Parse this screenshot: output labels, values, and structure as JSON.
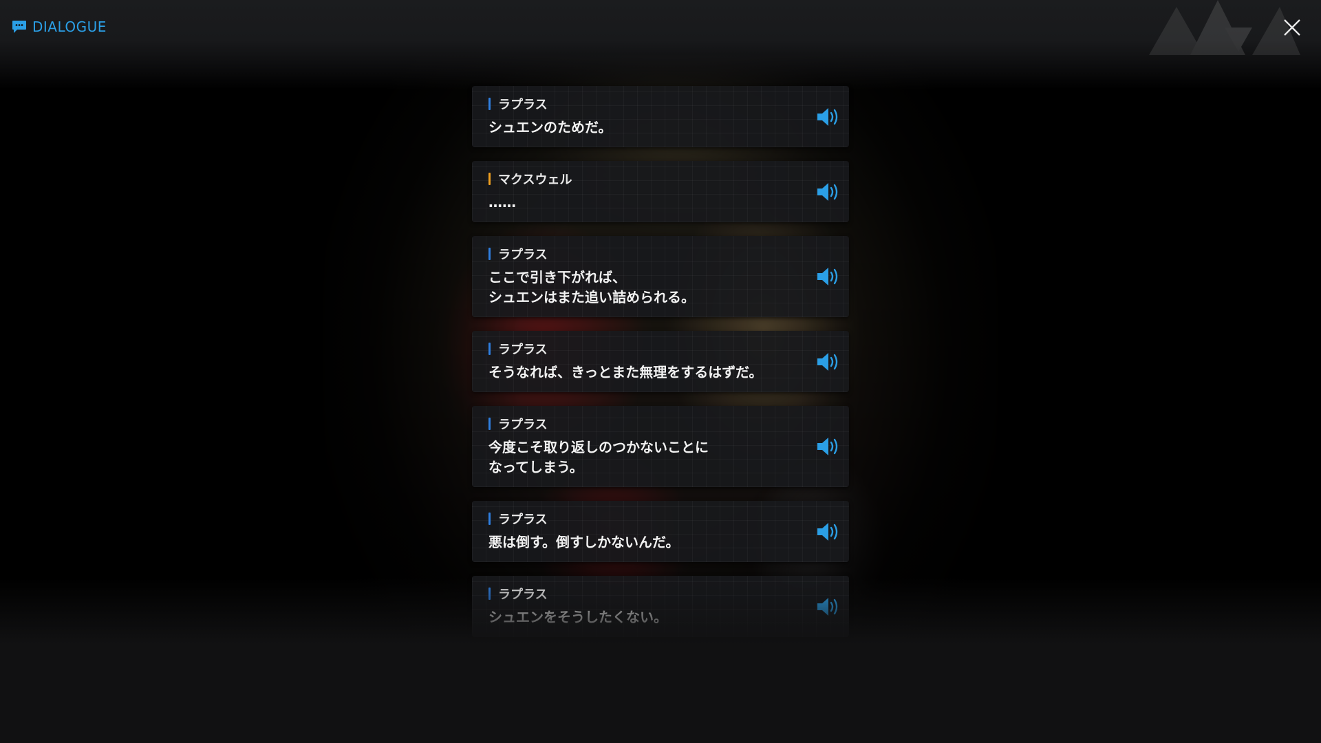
{
  "header": {
    "title": "DIALOGUE",
    "title_icon": "chat-bubble-icon",
    "close_icon": "close-icon"
  },
  "colors": {
    "accent": "#2b9fe6",
    "speaker_blue": "#2f7fe0",
    "speaker_orange": "#f0a020",
    "voice_icon": "#2b9fe6"
  },
  "dialogue": [
    {
      "speaker": "ラプラス",
      "speaker_color": "#2f7fe0",
      "text": "シュエンのためだ。",
      "voice_icon": "speaker-icon"
    },
    {
      "speaker": "マクスウェル",
      "speaker_color": "#f0a020",
      "text": "……",
      "voice_icon": "speaker-icon"
    },
    {
      "speaker": "ラプラス",
      "speaker_color": "#2f7fe0",
      "text": "ここで引き下がれば、\nシュエンはまた追い詰められる。",
      "voice_icon": "speaker-icon"
    },
    {
      "speaker": "ラプラス",
      "speaker_color": "#2f7fe0",
      "text": "そうなれば、きっとまた無理をするはずだ。",
      "voice_icon": "speaker-icon"
    },
    {
      "speaker": "ラプラス",
      "speaker_color": "#2f7fe0",
      "text": "今度こそ取り返しのつかないことに\nなってしまう。",
      "voice_icon": "speaker-icon"
    },
    {
      "speaker": "ラプラス",
      "speaker_color": "#2f7fe0",
      "text": "悪は倒す。倒すしかないんだ。",
      "voice_icon": "speaker-icon"
    },
    {
      "speaker": "ラプラス",
      "speaker_color": "#2f7fe0",
      "text": "シュエンをそうしたくない。",
      "voice_icon": "speaker-icon"
    }
  ]
}
